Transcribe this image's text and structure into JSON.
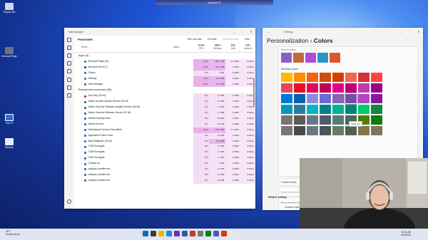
{
  "window_bar": {
    "title": "Surface Pi"
  },
  "desktop": {
    "icons": [
      {
        "label": "Recycle Bin"
      },
      {
        "label": "Microsoft Edge"
      },
      {
        "label": "This PC"
      },
      {
        "label": "Network"
      }
    ]
  },
  "task_manager": {
    "title": "Task Manager",
    "page": "Processes",
    "actions": [
      "Run new task",
      "End task",
      "Efficiency mode",
      "View"
    ],
    "columns": {
      "name": "Name",
      "status": "Status",
      "cpu": {
        "pct": "54%",
        "label": "CPU"
      },
      "memory": {
        "pct": "48%",
        "label": "Memory"
      },
      "disk": {
        "pct": "0%",
        "label": "Disk"
      },
      "network": {
        "pct": "0%",
        "label": "Network"
      }
    },
    "apps_header": "Apps (5)",
    "apps": [
      {
        "name": "Microsoft Edge (19)",
        "cpu": "2.6%",
        "mem": "468.7 MB",
        "disk": "0.1 MB/s",
        "net": "0 Mbps",
        "color": "#1a8fd6"
      },
      {
        "name": "Microsoft Word (7)",
        "cpu": "1.9%",
        "mem": "118.7 MB",
        "disk": "0 MB/s",
        "net": "0 Mbps",
        "color": "#2b5aa8"
      },
      {
        "name": "Photos",
        "cpu": "0%",
        "mem": "0 MB",
        "disk": "0 MB/s",
        "net": "0 Mbps",
        "color": "#3c7be0"
      },
      {
        "name": "Settings",
        "cpu": "4.6%",
        "mem": "42.4 MB",
        "disk": "0 MB/s",
        "net": "0 Mbps",
        "color": "#777"
      },
      {
        "name": "Task Manager",
        "cpu": "8.3%",
        "mem": "40.8 MB",
        "disk": "0 MB/s",
        "net": "0 Mbps",
        "color": "#2e8b57"
      }
    ],
    "bg_header": "Background processes (96)",
    "background": [
      {
        "name": "AcroTray (32 bit)",
        "cpu": "0%",
        "mem": "2.3 MB",
        "disk": "0 MB/s",
        "net": "0 Mbps",
        "color": "#c33"
      },
      {
        "name": "Adobe Acrobat Update Service (32 bit)",
        "cpu": "0%",
        "mem": "0.6 MB",
        "disk": "0 MB/s",
        "net": "0 Mbps",
        "color": "#4a6fb5"
      },
      {
        "name": "Adobe Genuine Software Integrity Service (32 bit)",
        "cpu": "0%",
        "mem": "1.3 MB",
        "disk": "0 MB/s",
        "net": "0 Mbps",
        "color": "#4a6fb5"
      },
      {
        "name": "Adobe Genuine Software Service (32 bit)",
        "cpu": "0%",
        "mem": "1.7 MB",
        "disk": "0 MB/s",
        "net": "0 Mbps",
        "color": "#4a6fb5"
      },
      {
        "name": "Akelius Desktop Alert",
        "cpu": "0%",
        "mem": "0.8 MB",
        "disk": "0 MB/s",
        "net": "0 Mbps",
        "color": "#4a6fb5"
      },
      {
        "name": "Akelus Service",
        "cpu": "0%",
        "mem": "0.6 MB",
        "disk": "0 MB/s",
        "net": "0 Mbps",
        "color": "#4a6fb5"
      },
      {
        "name": "Antimalware Service Executable",
        "cpu": "2.2%",
        "mem": "163.1 MB",
        "disk": "0.1 MB/s",
        "net": "0 Mbps",
        "color": "#4a6fb5"
      },
      {
        "name": "Application Frame Host",
        "cpu": "0%",
        "mem": "5.6 MB",
        "disk": "0 MB/s",
        "net": "0 Mbps",
        "color": "#4a6fb5"
      },
      {
        "name": "Bing Wallpaper (32 bit)",
        "cpu": "0%",
        "mem": "29.0 MB",
        "disk": "0 MB/s",
        "net": "0 Mbps",
        "color": "#1a8fd6"
      },
      {
        "name": "COM Surrogate",
        "cpu": "0%",
        "mem": "1.8 MB",
        "disk": "0 MB/s",
        "net": "0 Mbps",
        "color": "#4a6fb5"
      },
      {
        "name": "COM Surrogate",
        "cpu": "0%",
        "mem": "1.3 MB",
        "disk": "0 MB/s",
        "net": "0 Mbps",
        "color": "#4a6fb5"
      },
      {
        "name": "COM Surrogate",
        "cpu": "0%",
        "mem": "1.7 MB",
        "disk": "0 MB/s",
        "net": "0 Mbps",
        "color": "#4a6fb5"
      },
      {
        "name": "Cortana (2)",
        "cpu": "0%",
        "mem": "0 MB",
        "disk": "0 MB/s",
        "net": "0 Mbps",
        "color": "#4a6fb5"
      },
      {
        "name": "csslipad_handler.exe",
        "cpu": "0%",
        "mem": "2.3 MB",
        "disk": "0 MB/s",
        "net": "0 Mbps",
        "color": "#4a6fb5"
      },
      {
        "name": "csslipad_handler.exe",
        "cpu": "0%",
        "mem": "0.9 MB",
        "disk": "0 MB/s",
        "net": "0 Mbps",
        "color": "#4a6fb5"
      },
      {
        "name": "csslipad_handler.exe",
        "cpu": "0%",
        "mem": "0.9 MB",
        "disk": "0 MB/s",
        "net": "0 Mbps",
        "color": "#4a6fb5"
      }
    ]
  },
  "settings": {
    "title": "Settings",
    "breadcrumb_parent": "Personalization",
    "breadcrumb_sep": "›",
    "breadcrumb_current": "Colors",
    "recent_label": "Recent colors",
    "recent": [
      "#8b5fc2",
      "#c06a3c",
      "#b04ad8",
      "#2a96c8",
      "#e0562a"
    ],
    "windows_label": "Windows colors",
    "palette": [
      "#ffb900",
      "#ff8c00",
      "#f7630c",
      "#ca5010",
      "#da3b01",
      "#ef6950",
      "#d13438",
      "#ff4343",
      "#e74856",
      "#e81123",
      "#ea005e",
      "#c30052",
      "#e3008c",
      "#bf0077",
      "#c239b3",
      "#9a0089",
      "#0078d7",
      "#0063b1",
      "#8e8cd8",
      "#6b69d6",
      "#8764b8",
      "#744da9",
      "#b146c2",
      "#881798",
      "#0099bc",
      "#2d7d9a",
      "#00b7c3",
      "#038387",
      "#00b294",
      "#018574",
      "#00cc6a",
      "#10893e",
      "#7a7574",
      "#5d5a58",
      "#68768a",
      "#515c6b",
      "#567c73",
      "#486860",
      "#498205",
      "#107c10",
      "#767676",
      "#4c4a48",
      "#69797e",
      "#4a5459",
      "#647c64",
      "#525e54",
      "#847545",
      "#7e735f"
    ],
    "tooltip": "Violet red",
    "custom_label": "Custom colors",
    "view_colors": "View colors",
    "accent_start": "Show accent color on Start and taskbar",
    "accent_title": "Show accent color on title bars and window borders",
    "related": "Related settings",
    "contrast": "Contrast themes"
  },
  "taskbar": {
    "weather_temp": "48°F",
    "weather_desc": "Mostly cloudy",
    "time": "10:01 AM",
    "date": "4/26/2024",
    "apps": [
      "#0f6cbd",
      "#3c3c3c",
      "#f0b400",
      "#1a8fd6",
      "#6b2fba",
      "#2b5aa8",
      "#c43e1c",
      "#777",
      "#107c10",
      "#5558af",
      "#d83b01",
      "#e8e8e8"
    ]
  }
}
